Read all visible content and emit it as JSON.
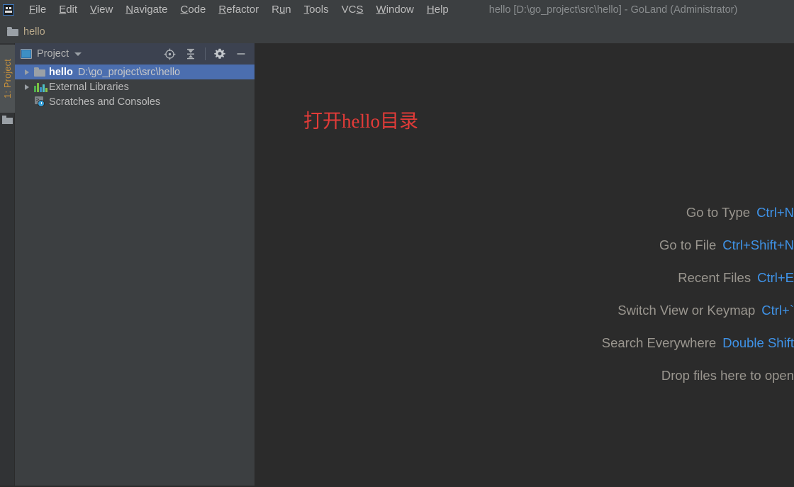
{
  "window": {
    "title": "hello [D:\\go_project\\src\\hello] - GoLand (Administrator)",
    "app_icon": "goland-icon"
  },
  "menubar": {
    "items": [
      {
        "label": "File",
        "mnemonic": "F"
      },
      {
        "label": "Edit",
        "mnemonic": "E"
      },
      {
        "label": "View",
        "mnemonic": "V"
      },
      {
        "label": "Navigate",
        "mnemonic": "N"
      },
      {
        "label": "Code",
        "mnemonic": "C"
      },
      {
        "label": "Refactor",
        "mnemonic": "R"
      },
      {
        "label": "Run",
        "mnemonic": "u"
      },
      {
        "label": "Tools",
        "mnemonic": "T"
      },
      {
        "label": "VCS",
        "mnemonic": "S"
      },
      {
        "label": "Window",
        "mnemonic": "W"
      },
      {
        "label": "Help",
        "mnemonic": "H"
      }
    ]
  },
  "navbar": {
    "crumb": "hello",
    "crumb_icon": "folder-icon"
  },
  "toolstrip": {
    "tab_label": "1: Project",
    "tab_icon": "project-folder-icon"
  },
  "project_panel": {
    "title": "Project",
    "title_icon": "project-view-icon",
    "dropdown_icon": "chevron-down-icon",
    "actions": [
      {
        "name": "scroll-from-source-button",
        "icon": "crosshair-target-icon"
      },
      {
        "name": "collapse-all-button",
        "icon": "collapse-all-icon"
      },
      {
        "name": "panel-settings-button",
        "icon": "gear-icon"
      },
      {
        "name": "hide-panel-button",
        "icon": "minimize-icon"
      }
    ],
    "tree": [
      {
        "label": "hello",
        "path": "D:\\go_project\\src\\hello",
        "icon": "folder-icon",
        "expandable": true,
        "selected": true,
        "bold": true
      },
      {
        "label": "External Libraries",
        "path": "",
        "icon": "library-bars-icon",
        "expandable": true,
        "selected": false,
        "bold": false
      },
      {
        "label": "Scratches and Consoles",
        "path": "",
        "icon": "scratches-console-icon",
        "expandable": false,
        "selected": false,
        "bold": false
      }
    ]
  },
  "editor": {
    "annotation": "打开hello目录",
    "annotation_color": "#e23b38",
    "hints": [
      {
        "label": "Go to Type",
        "key": "Ctrl+N"
      },
      {
        "label": "Go to File",
        "key": "Ctrl+Shift+N"
      },
      {
        "label": "Recent Files",
        "key": "Ctrl+E"
      },
      {
        "label": "Switch View or Keymap",
        "key": "Ctrl+`"
      },
      {
        "label": "Search Everywhere",
        "key": "Double Shift"
      },
      {
        "label": "Drop files here to open",
        "key": ""
      }
    ],
    "hint_key_color": "#3f93e8"
  },
  "colors": {
    "chrome": "#3c3f41",
    "editor_bg": "#2b2b2b",
    "selection": "#4b6eaf",
    "panel_header": "#3c4250",
    "accent_blue": "#3f93e8",
    "annotation_red": "#e23b38",
    "tab_accent": "#c8923c"
  },
  "library_bar_colors": [
    "#4caf50",
    "#7cc242",
    "#3d8fc4",
    "#4fc3c3",
    "#8bc34a"
  ]
}
